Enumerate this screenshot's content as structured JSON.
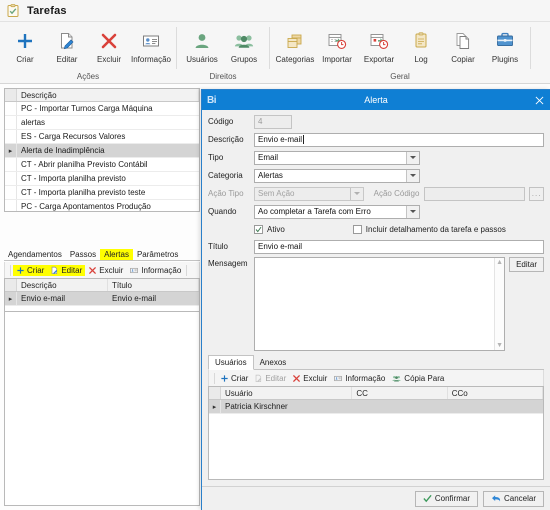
{
  "window": {
    "title": "Tarefas",
    "icon": "clipboard-check-icon"
  },
  "ribbon": {
    "groups": [
      {
        "label": "Ações",
        "buttons": [
          {
            "label": "Criar",
            "icon": "plus-icon"
          },
          {
            "label": "Editar",
            "icon": "pencil-page-icon"
          },
          {
            "label": "Excluir",
            "icon": "x-icon"
          },
          {
            "label": "Informação",
            "icon": "id-card-icon"
          }
        ]
      },
      {
        "label": "Direitos",
        "buttons": [
          {
            "label": "Usuários",
            "icon": "user-icon"
          },
          {
            "label": "Grupos",
            "icon": "users-group-icon"
          }
        ]
      },
      {
        "label": "Geral",
        "buttons": [
          {
            "label": "Categorias",
            "icon": "boxes-icon"
          },
          {
            "label": "Importar",
            "icon": "calendar-import-icon"
          },
          {
            "label": "Exportar",
            "icon": "calendar-export-icon"
          },
          {
            "label": "Log",
            "icon": "clipboard-icon"
          },
          {
            "label": "Copiar",
            "icon": "copy-pages-icon"
          },
          {
            "label": "Plugins",
            "icon": "briefcase-icon"
          }
        ]
      }
    ]
  },
  "task_grid": {
    "columns": [
      "Descrição"
    ],
    "rows": [
      {
        "descricao": "PC - Importar Turnos Carga Máquina",
        "selected": false
      },
      {
        "descricao": "alertas",
        "selected": false
      },
      {
        "descricao": "ES - Carga Recursos Valores",
        "selected": false
      },
      {
        "descricao": "Alerta de Inadimplência",
        "selected": true
      },
      {
        "descricao": "CT - Abrir planilha Previsto Contábil",
        "selected": false
      },
      {
        "descricao": "CT - Importa planilha previsto",
        "selected": false
      },
      {
        "descricao": "CT - Importa planilha previsto teste",
        "selected": false
      },
      {
        "descricao": "PC - Carga Apontamentos Produção",
        "selected": false
      }
    ]
  },
  "detail_tabs": {
    "items": [
      {
        "label": "Agendamentos",
        "highlight": false
      },
      {
        "label": "Passos",
        "highlight": false
      },
      {
        "label": "Alertas",
        "highlight": true
      },
      {
        "label": "Parâmetros",
        "highlight": false
      }
    ]
  },
  "detail_toolbar": {
    "buttons": [
      {
        "label": "Criar",
        "icon": "plus-icon",
        "highlight": true,
        "disabled": false
      },
      {
        "label": "Editar",
        "icon": "pencil-page-icon",
        "highlight": true,
        "disabled": false
      },
      {
        "label": "Excluir",
        "icon": "x-icon",
        "highlight": false,
        "disabled": false
      },
      {
        "label": "Informação",
        "icon": "id-card-icon",
        "highlight": false,
        "disabled": false
      }
    ]
  },
  "alert_grid": {
    "columns": [
      "Descrição",
      "Título"
    ],
    "rows": [
      {
        "descricao": "Envio e-mail",
        "titulo": "Envio e-mail",
        "selected": true
      }
    ]
  },
  "dialog": {
    "logo": "Bi",
    "caption": "Alerta",
    "close_icon": "close-icon",
    "fields": {
      "codigo_label": "Código",
      "codigo_value": "4",
      "descricao_label": "Descrição",
      "descricao_value": "Envio e-mail",
      "tipo_label": "Tipo",
      "tipo_value": "Email",
      "categoria_label": "Categoria",
      "categoria_value": "Alertas",
      "acao_tipo_label": "Ação Tipo",
      "acao_tipo_value": "Sem Ação",
      "acao_codigo_label": "Ação Código",
      "acao_codigo_value": "",
      "acao_codigo_browse": "...",
      "quando_label": "Quando",
      "quando_value": "Ao completar a Tarefa com Erro",
      "ativo_label": "Ativo",
      "ativo_checked": true,
      "incluir_label": "Incluir detalhamento da tarefa e passos",
      "incluir_checked": false,
      "titulo_label": "Título",
      "titulo_value": "Envio e-mail",
      "mensagem_label": "Mensagem",
      "mensagem_value": "",
      "editar_button": "Editar"
    },
    "users_section": {
      "tabs": [
        {
          "label": "Usuários",
          "active": true
        },
        {
          "label": "Anexos",
          "active": false
        }
      ],
      "toolbar": [
        {
          "label": "Criar",
          "icon": "plus-icon",
          "disabled": false
        },
        {
          "label": "Editar",
          "icon": "pencil-page-icon",
          "disabled": true
        },
        {
          "label": "Excluir",
          "icon": "x-icon",
          "disabled": false
        },
        {
          "label": "Informação",
          "icon": "id-card-icon",
          "disabled": false
        },
        {
          "label": "Cópia Para",
          "icon": "users-group-icon",
          "disabled": false
        }
      ],
      "columns": [
        "Usuário",
        "CC",
        "CCo"
      ],
      "rows": [
        {
          "usuario": "Patricia Kirschner",
          "cc": "",
          "cco": "",
          "selected": true
        }
      ]
    },
    "footer": {
      "confirm_label": "Confirmar",
      "confirm_icon": "check-icon",
      "cancel_label": "Cancelar",
      "cancel_icon": "back-arrow-icon"
    }
  },
  "colors": {
    "title_bar": "#0f7fd4",
    "highlight": "#ffff00",
    "accent_blue": "#1e73be",
    "accent_red": "#d9413a",
    "accent_green": "#6aa57f",
    "accent_gold": "#e0c083"
  }
}
